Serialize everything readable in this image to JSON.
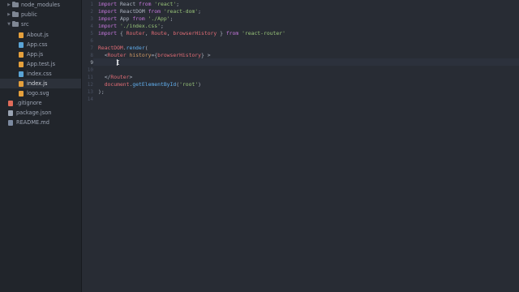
{
  "sidebar": {
    "items": [
      {
        "label": "node_modules",
        "type": "folder",
        "expanded": false,
        "depth": 0,
        "icon": "folder-icon"
      },
      {
        "label": "public",
        "type": "folder",
        "expanded": false,
        "depth": 0,
        "icon": "folder-icon"
      },
      {
        "label": "src",
        "type": "folder",
        "expanded": true,
        "depth": 0,
        "icon": "folder-icon"
      },
      {
        "label": "About.js",
        "type": "file",
        "depth": 1,
        "icon": "js-file-icon",
        "color": "#e5a03c"
      },
      {
        "label": "App.css",
        "type": "file",
        "depth": 1,
        "icon": "css-file-icon",
        "color": "#5aa4d6"
      },
      {
        "label": "App.js",
        "type": "file",
        "depth": 1,
        "icon": "js-file-icon",
        "color": "#e5a03c"
      },
      {
        "label": "App.test.js",
        "type": "file",
        "depth": 1,
        "icon": "js-file-icon",
        "color": "#e5a03c"
      },
      {
        "label": "index.css",
        "type": "file",
        "depth": 1,
        "icon": "css-file-icon",
        "color": "#5aa4d6"
      },
      {
        "label": "index.js",
        "type": "file",
        "depth": 1,
        "icon": "js-file-icon",
        "color": "#e5a03c",
        "selected": true
      },
      {
        "label": "logo.svg",
        "type": "file",
        "depth": 1,
        "icon": "svg-file-icon",
        "color": "#e5a03c"
      },
      {
        "label": ".gitignore",
        "type": "file",
        "depth": 0,
        "icon": "git-file-icon",
        "color": "#e06c5a"
      },
      {
        "label": "package.json",
        "type": "file",
        "depth": 0,
        "icon": "json-file-icon",
        "color": "#9aa4b3"
      },
      {
        "label": "README.md",
        "type": "file",
        "depth": 0,
        "icon": "markdown-file-icon",
        "color": "#7c8aa0"
      }
    ]
  },
  "editor": {
    "active_line": 9,
    "lines": [
      {
        "n": "1",
        "tokens": [
          [
            "k",
            "import "
          ],
          [
            "p",
            "React "
          ],
          [
            "k",
            "from "
          ],
          [
            "s",
            "'react'"
          ],
          [
            "p",
            ";"
          ]
        ]
      },
      {
        "n": "2",
        "tokens": [
          [
            "k",
            "import "
          ],
          [
            "p",
            "ReactDOM "
          ],
          [
            "k",
            "from "
          ],
          [
            "s",
            "'react-dom'"
          ],
          [
            "p",
            ";"
          ]
        ]
      },
      {
        "n": "3",
        "tokens": [
          [
            "k",
            "import "
          ],
          [
            "p",
            "App "
          ],
          [
            "k",
            "from "
          ],
          [
            "s",
            "'./App'"
          ],
          [
            "p",
            ";"
          ]
        ]
      },
      {
        "n": "4",
        "tokens": [
          [
            "k",
            "import "
          ],
          [
            "s",
            "'./index.css'"
          ],
          [
            "p",
            ";"
          ]
        ]
      },
      {
        "n": "5",
        "tokens": [
          [
            "k",
            "import "
          ],
          [
            "p",
            "{ "
          ],
          [
            "t",
            "Router"
          ],
          [
            "p",
            ", "
          ],
          [
            "t",
            "Route"
          ],
          [
            "p",
            ", "
          ],
          [
            "t",
            "browserHistory"
          ],
          [
            "p",
            " } "
          ],
          [
            "k",
            "from "
          ],
          [
            "s",
            "'react-router'"
          ]
        ]
      },
      {
        "n": "6",
        "tokens": []
      },
      {
        "n": "7",
        "tokens": [
          [
            "t",
            "ReactDOM"
          ],
          [
            "p",
            "."
          ],
          [
            "f",
            "render"
          ],
          [
            "p",
            "("
          ]
        ]
      },
      {
        "n": "8",
        "tokens": [
          [
            "p",
            "  <"
          ],
          [
            "t",
            "Router"
          ],
          [
            "p",
            " "
          ],
          [
            "a",
            "history"
          ],
          [
            "p",
            "={"
          ],
          [
            "t",
            "browserHistory"
          ],
          [
            "p",
            "} >"
          ]
        ]
      },
      {
        "n": "9",
        "tokens": []
      },
      {
        "n": "10",
        "tokens": []
      },
      {
        "n": "11",
        "tokens": [
          [
            "p",
            "  </"
          ],
          [
            "t",
            "Router"
          ],
          [
            "p",
            ">"
          ]
        ]
      },
      {
        "n": "12",
        "tokens": [
          [
            "p",
            "  "
          ],
          [
            "t",
            "document"
          ],
          [
            "p",
            "."
          ],
          [
            "f",
            "getElementById"
          ],
          [
            "p",
            "("
          ],
          [
            "s",
            "'root'"
          ],
          [
            "p",
            ")"
          ]
        ]
      },
      {
        "n": "13",
        "tokens": [
          [
            "p",
            ");"
          ]
        ]
      },
      {
        "n": "14",
        "tokens": []
      }
    ]
  }
}
